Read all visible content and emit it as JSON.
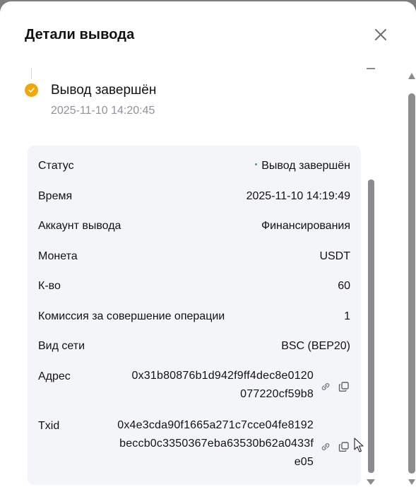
{
  "modal": {
    "title": "Детали вывода"
  },
  "timeline": {
    "step_title": "Вывод завершён",
    "step_time": "2025-11-10 14:20:45"
  },
  "details": {
    "status_label": "Статус",
    "status_value": "Вывод завершён",
    "time_label": "Время",
    "time_value": "2025-11-10 14:19:49",
    "account_label": "Аккаунт вывода",
    "account_value": "Финансирования",
    "coin_label": "Монета",
    "coin_value": "USDT",
    "qty_label": "К-во",
    "qty_value": "60",
    "fee_label": "Комиссия за совершение операции",
    "fee_value": "1",
    "network_label": "Вид сети",
    "network_value": "BSC (BEP20)",
    "address_label": "Адрес",
    "address_line1": "0x31b80876b1d942f9ff4dec8e0120",
    "address_line2": "077220cf59b8",
    "txid_label": "Txid",
    "txid_line1": "0x4e3cda90f1665a271c7cce04fe8192",
    "txid_line2": "beccb0c3350367eba63530b62a0433f",
    "txid_line3": "e05"
  },
  "colors": {
    "status_dot": "#20b26c",
    "step_icon": "#f0a70a",
    "card_bg": "#f4f5f9"
  }
}
